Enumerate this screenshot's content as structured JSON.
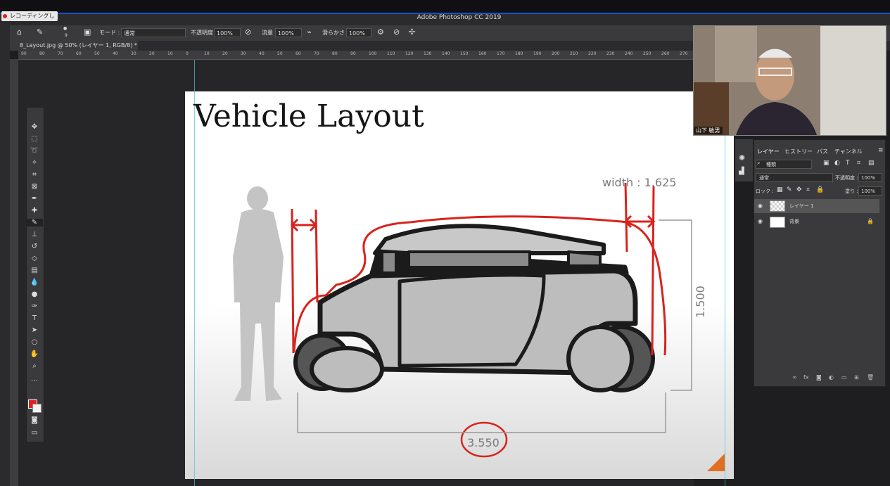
{
  "system": {
    "recording_badge": "レコーディングしています..."
  },
  "app": {
    "title": "Adobe Photoshop CC 2019"
  },
  "options_bar": {
    "brush_size": "9",
    "mode_label": "モード :",
    "mode_value": "通常",
    "opacity_label": "不透明度 :",
    "opacity_value": "100%",
    "flow_label": "流量 :",
    "flow_value": "100%",
    "smoothing_label": "滑らかさ :",
    "smoothing_value": "100%"
  },
  "document_tab": {
    "label": "8_Layout.jpg @ 50% (レイヤー 1, RGB/8) *"
  },
  "ruler_ticks": [
    "90",
    "80",
    "70",
    "60",
    "50",
    "40",
    "30",
    "20",
    "10",
    "0",
    "10",
    "20",
    "30",
    "40",
    "50",
    "60",
    "70",
    "80",
    "90",
    "100",
    "110",
    "120",
    "130",
    "140",
    "150",
    "160",
    "170",
    "180",
    "190",
    "200",
    "210",
    "220",
    "230",
    "240",
    "250",
    "260",
    "270"
  ],
  "canvas": {
    "title": "Vehicle Layout",
    "width_label": "width : 1.625",
    "height_label": "1.500",
    "length_label": "3.550"
  },
  "webcam": {
    "name": "山下 敏男"
  },
  "layers_panel": {
    "tabs": [
      "レイヤー",
      "ヒストリー",
      "パス",
      "チャンネル"
    ],
    "filter_label": "種類",
    "blend_mode": "通常",
    "opacity_label": "不透明度 :",
    "opacity_value": "100%",
    "lock_label": "ロック :",
    "fill_label": "塗り :",
    "fill_value": "100%",
    "layers": [
      {
        "name": "レイヤー 1",
        "selected": true
      },
      {
        "name": "背景",
        "selected": false
      }
    ]
  },
  "colors": {
    "foreground": "#e01f1f",
    "background": "#f2f2f2",
    "accent": "#1a4fd0"
  }
}
